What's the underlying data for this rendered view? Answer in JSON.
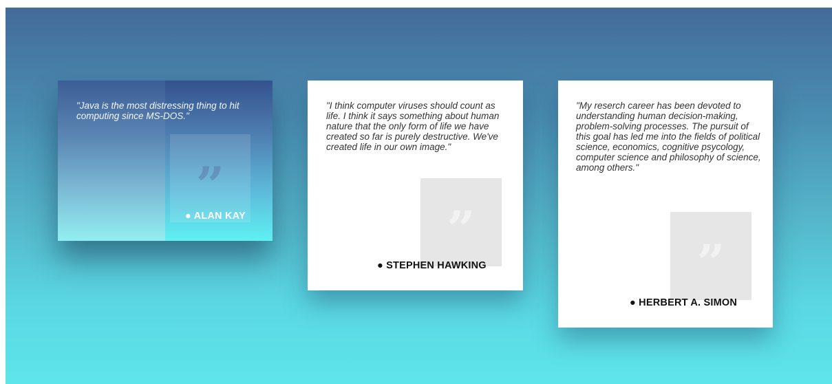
{
  "cards": [
    {
      "quote": "\"Java is the most distressing thing to hit computing since MS-DOS.\"",
      "author": "● ALAN KAY",
      "quote_mark": "”"
    },
    {
      "quote": "\"I think computer viruses should count as life. I think it says something about human nature that the only form of life we have created so far is purely destructive. We've created life in our own image.\"",
      "author": "● STEPHEN HAWKING",
      "quote_mark": "”"
    },
    {
      "quote": "\"My reserch career has been devoted to understanding human decision-making, problem-solving processes. The pursuit of this goal has led me into the fields of political science, economics, cognitive psycology, computer science and philosophy of science, among others.\"",
      "author": "● HERBERT A. SIMON",
      "quote_mark": "”"
    }
  ],
  "colors": {
    "background_top": "#436b9a",
    "background_bottom": "#5ee5ea",
    "card_background": "#ffffff",
    "quote_box": "#e6e6e6"
  },
  "icons": {
    "quote_icon": "closing-quotation-mark"
  }
}
